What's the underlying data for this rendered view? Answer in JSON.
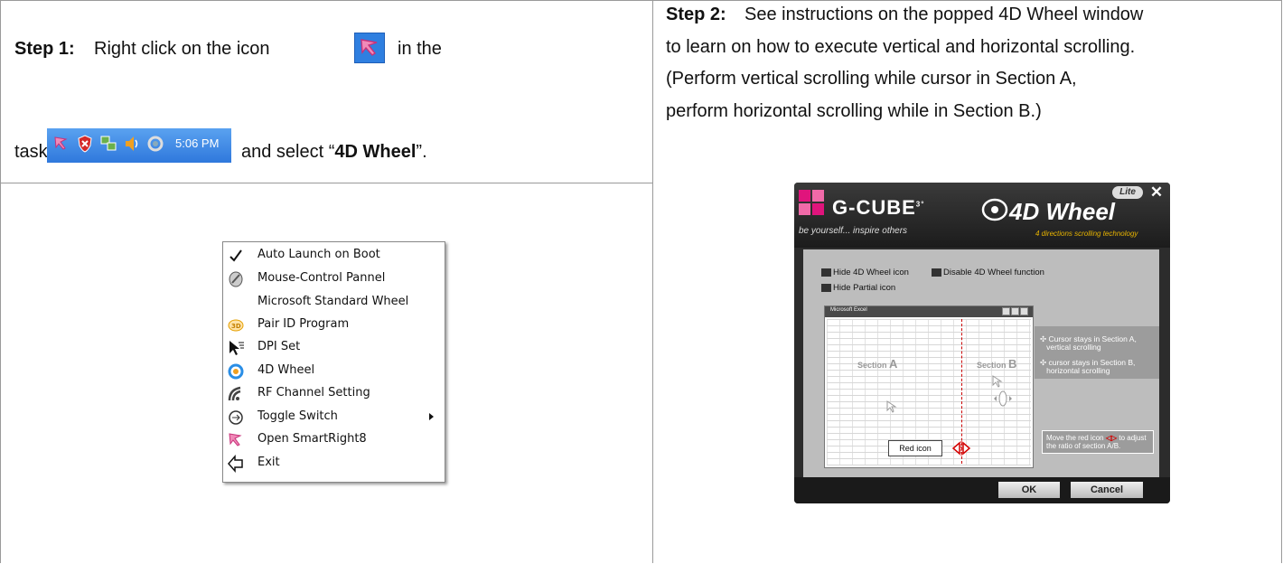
{
  "step1": {
    "label": "Step 1:",
    "text_a": "Right click on the icon",
    "text_b": "in the",
    "text_c": "taskbar",
    "text_d": "and select “",
    "highlight": "4D Wheel",
    "text_e": "”."
  },
  "taskbar": {
    "time": "5:06 PM"
  },
  "menu": {
    "items": [
      {
        "label": "Auto Launch on Boot",
        "icon": "checkmark-icon"
      },
      {
        "label": "Mouse-Control Pannel",
        "icon": "mouse-control-icon"
      },
      {
        "label": "Microsoft Standard Wheel",
        "icon": ""
      },
      {
        "label": "Pair ID Program",
        "icon": "pair-id-icon"
      },
      {
        "label": "DPI Set",
        "icon": "dpi-cursor-icon"
      },
      {
        "label": "4D Wheel",
        "icon": "4d-wheel-icon"
      },
      {
        "label": "RF Channel Setting",
        "icon": "rf-signal-icon"
      },
      {
        "label": "Toggle Switch",
        "icon": "toggle-icon"
      },
      {
        "label": "Open SmartRight8",
        "icon": "smartright-icon"
      },
      {
        "label": "Exit",
        "icon": "exit-icon"
      }
    ]
  },
  "step2": {
    "label": "Step 2:",
    "line1": "See instructions on the popped 4D Wheel window",
    "line2": "to learn on how to execute vertical and horizontal scrolling.",
    "line3": "(Perform vertical scrolling while cursor in Section A,",
    "line4": "perform horizontal scrolling while in Section B.)"
  },
  "window": {
    "brand": "G-CUBE",
    "brand_sup": "3°",
    "slogan": "be yourself... inspire others",
    "product": "4D Wheel",
    "product_sub": "4 directions scrolling technology",
    "badge": "Lite",
    "close": "✕",
    "opt_hide_icon": "Hide 4D Wheel icon",
    "opt_disable": "Disable 4D Wheel function",
    "opt_hide_partial": "Hide Partial icon",
    "excel_title": "Microsoft Excel",
    "section_word": "Section",
    "section_a": "A",
    "section_b": "B",
    "red_icon_label": "Red icon",
    "note_a1": "Cursor stays in Section A,",
    "note_a2": "vertical scrolling",
    "note_b1": "cursor stays in Section B,",
    "note_b2": "horizontal scrolling",
    "tip1": "Move the red icon",
    "tip2": "to adjust",
    "tip3": "the ratio of section A/B.",
    "ok": "OK",
    "cancel": "Cancel"
  },
  "colors": {
    "taskbar": "#3a86e4",
    "menu_border": "#888888",
    "window_bg": "#2c2c2c",
    "logo_pink": "#e0147c"
  }
}
